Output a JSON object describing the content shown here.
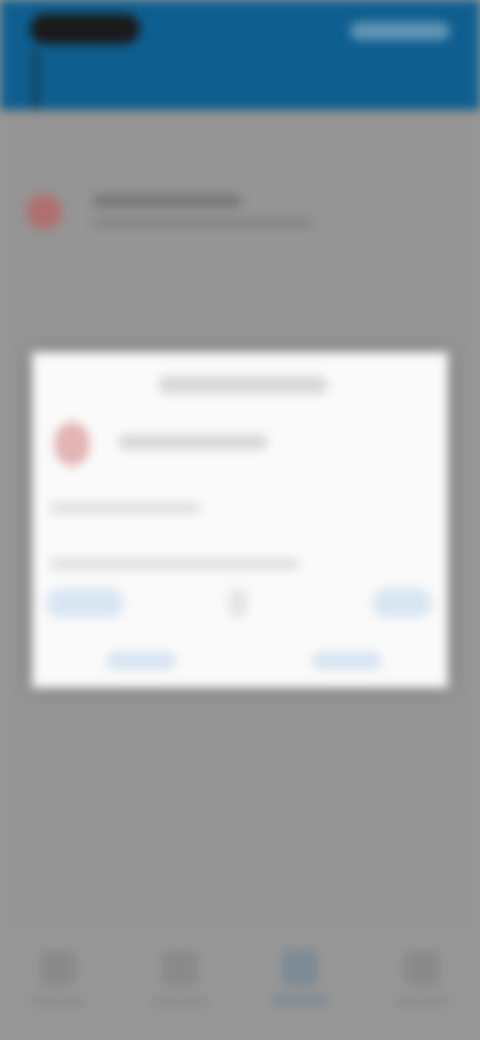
{
  "app": {
    "blurred": true
  }
}
